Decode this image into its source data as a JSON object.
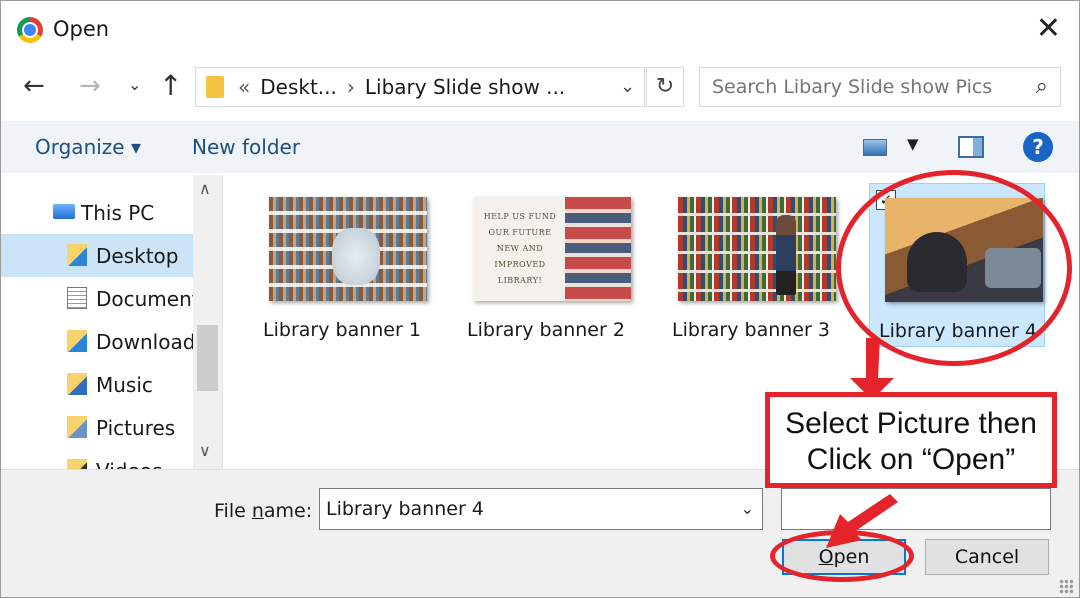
{
  "window": {
    "title": "Open"
  },
  "nav": {
    "address": {
      "prefix": "«",
      "crumb1": "Deskt...",
      "crumb2": "Libary Slide show ..."
    },
    "search_placeholder": "Search Libary Slide show Pics"
  },
  "toolbar": {
    "organize": "Organize",
    "organize_caret": "▾",
    "new_folder": "New folder",
    "help": "?"
  },
  "sidebar": {
    "items": [
      {
        "label": "This PC",
        "icon": "pc-icon"
      },
      {
        "label": "Desktop",
        "icon": "desktop-folder-icon",
        "selected": true
      },
      {
        "label": "Documents",
        "icon": "documents-icon"
      },
      {
        "label": "Downloads",
        "icon": "downloads-icon"
      },
      {
        "label": "Music",
        "icon": "music-icon"
      },
      {
        "label": "Pictures",
        "icon": "pictures-icon"
      },
      {
        "label": "Videos",
        "icon": "videos-icon"
      }
    ]
  },
  "files": [
    {
      "name": "Library banner 1"
    },
    {
      "name": "Library banner 2",
      "thumb_text": "HELP US FUND OUR FUTURE NEW AND IMPROVED LIBRARY!"
    },
    {
      "name": "Library banner 3"
    },
    {
      "name": "Library banner 4",
      "selected": true,
      "checked": "✓"
    }
  ],
  "bottom": {
    "file_name_label_pre": "File ",
    "file_name_label_key": "n",
    "file_name_label_post": "ame:",
    "file_name_value": "Library banner 4",
    "open_key": "O",
    "open_rest": "pen",
    "cancel": "Cancel"
  },
  "annotation": {
    "callout_line1": "Select Picture then",
    "callout_line2": "Click on “Open”",
    "color": "#e4232b"
  },
  "colors": {
    "selection": "#cce8ff",
    "toolbar_bg": "#f0f4f9",
    "link_blue": "#1d4f7f",
    "accent": "#0078d7"
  }
}
